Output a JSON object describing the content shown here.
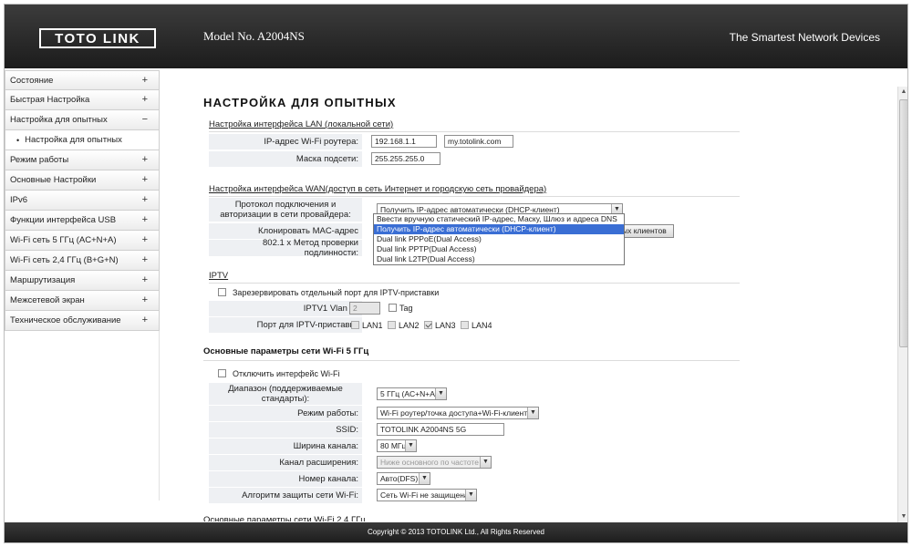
{
  "header": {
    "logo_text": "TOTO LINK",
    "model": "Model No. A2004NS",
    "tagline": "The Smartest Network Devices"
  },
  "sidebar": {
    "items": [
      {
        "label": "Состояние",
        "toggle": "+"
      },
      {
        "label": "Быстрая Настройка",
        "toggle": "+"
      },
      {
        "label": "Настройка для опытных",
        "toggle": "−"
      },
      {
        "label": "Режим работы",
        "toggle": "+"
      },
      {
        "label": "Основные Настройки",
        "toggle": "+"
      },
      {
        "label": "IPv6",
        "toggle": "+"
      },
      {
        "label": "Функции интерфейса USB",
        "toggle": "+"
      },
      {
        "label": "Wi-Fi сеть 5 ГГц (AC+N+A)",
        "toggle": "+"
      },
      {
        "label": "Wi-Fi сеть 2,4 ГГц (B+G+N)",
        "toggle": "+"
      },
      {
        "label": "Маршрутизация",
        "toggle": "+"
      },
      {
        "label": "Межсетевой экран",
        "toggle": "+"
      },
      {
        "label": "Техническое обслуживание",
        "toggle": "+"
      }
    ],
    "subitem": {
      "bullet": "•",
      "label": "Настройка для опытных"
    }
  },
  "page": {
    "title": "НАСТРОЙКА ДЛЯ ОПЫТНЫХ",
    "lan": {
      "heading": "Настройка интерфейса LAN (локальной сети)",
      "ip_label": "IP-адрес Wi-Fi роутера:",
      "ip_value": "192.168.1.1",
      "domain_value": "my.totolink.com",
      "mask_label": "Маска подсети:",
      "mask_value": "255.255.255.0"
    },
    "wan": {
      "heading": "Настройка интерфейса WAN(доступ в сеть Интернет и городскую сеть провайдера)",
      "protocol_label": "Протокол подключения и авторизации в сети провайдера:",
      "protocol_selected": "Получить IP-адрес автоматически (DHCP-клиент)",
      "options": [
        "Ввести вручную статический IP-адрес, Маску, Шлюз и адреса DNS",
        "Получить IP-адрес автоматически (DHCP-клиент)",
        "Dual link PPPoE(Dual Access)",
        "Dual link PPTP(Dual Access)",
        "Dual link L2TP(Dual Access)"
      ],
      "highlighted_option_index": 1,
      "clone_mac_label": "Клонировать MAC-адрес",
      "clone_button_label": "ых клиентов",
      "auth_label": "802.1 x Метод проверки подлинности:"
    },
    "iptv": {
      "heading": "IPTV",
      "reserve_label": "Зарезервировать отдельный порт для IPTV-приставки",
      "reserve_checked": false,
      "vlan_label": "IPTV1 Vlan ID",
      "vlan_value": "2",
      "tag_label": "Tag",
      "port_label": "Порт для IPTV-приставки",
      "ports": [
        {
          "label": "LAN1",
          "checked": false
        },
        {
          "label": "LAN2",
          "checked": false
        },
        {
          "label": "LAN3",
          "checked": true
        },
        {
          "label": "LAN4",
          "checked": false
        }
      ]
    },
    "wifi5": {
      "heading": "Основные параметры сети Wi-Fi 5 ГГц",
      "disable_label": "Отключить интерфейс Wi-Fi",
      "disable_checked": false,
      "band_label": "Диапазон (поддерживаемые стандарты):",
      "band_value": "5 ГГц (AC+N+A)",
      "mode_label": "Режим работы:",
      "mode_value": "Wi-Fi роутер/точка доступа+Wi-Fi-клиенты",
      "ssid_label": "SSID:",
      "ssid_value": "TOTOLINK A2004NS 5G",
      "width_label": "Ширина канала:",
      "width_value": "80 МГц",
      "ext_label": "Канал расширения:",
      "ext_value": "Ниже основного по частоте",
      "channel_label": "Номер канала:",
      "channel_value": "Авто(DFS)",
      "security_label": "Алгоритм защиты сети Wi-Fi:",
      "security_value": "Сеть Wi-Fi не защищена"
    },
    "wifi24_heading": "Основные параметры сети Wi-Fi 2,4 ГГц"
  },
  "footer": {
    "text": "Copyright © 2013 TOTOLINK Ltd.,   All Rights Reserved"
  }
}
